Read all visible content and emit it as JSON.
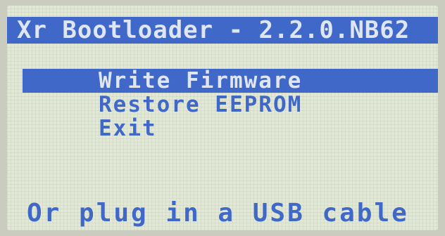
{
  "header": {
    "title": "Xr Bootloader - 2.2.0.NB62"
  },
  "menu": {
    "items": [
      {
        "label": "Write Firmware"
      },
      {
        "label": "Restore EEPROM"
      },
      {
        "label": "Exit"
      }
    ],
    "selected_index": 0
  },
  "footer": {
    "hint": "Or plug in a USB cable"
  },
  "colors": {
    "lcd_background": "#e2e8d6",
    "lcd_foreground": "#3f68c8",
    "inverted_text": "#dfe6f2"
  }
}
